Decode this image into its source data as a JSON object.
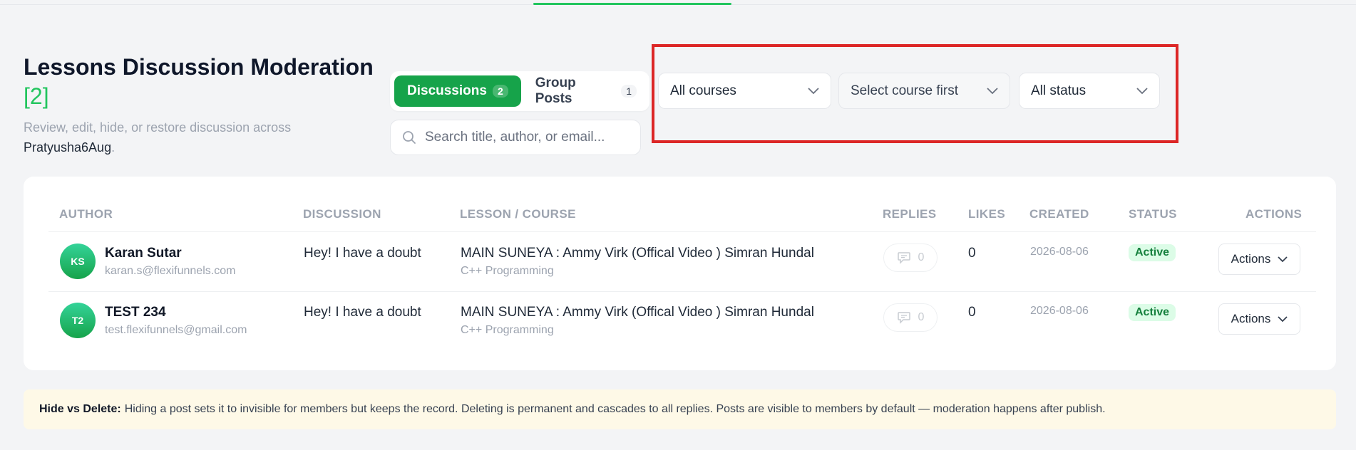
{
  "header": {
    "title": "Lessons Discussion Moderation",
    "count": "[2]",
    "subtitle_prefix": "Review, edit, hide, or restore discussion across",
    "site_name": "Pratyusha6Aug",
    "subtitle_suffix": "."
  },
  "tabs": [
    {
      "label": "Discussions",
      "badge": "2",
      "active": true
    },
    {
      "label": "Group Posts",
      "badge": "1",
      "active": false
    }
  ],
  "search": {
    "placeholder": "Search title, author, or email..."
  },
  "filters": {
    "courses": "All courses",
    "lessons": "Select course first",
    "status": "All status"
  },
  "table": {
    "columns": [
      "AUTHOR",
      "DISCUSSION",
      "LESSON / COURSE",
      "REPLIES",
      "LIKES",
      "CREATED",
      "STATUS",
      "ACTIONS"
    ],
    "rows": [
      {
        "initials": "KS",
        "author": "Karan Sutar",
        "email": "karan.s@flexifunnels.com",
        "discussion": "Hey! I have a doubt",
        "lesson": "MAIN SUNEYA : Ammy Virk (Offical Video ) Simran Hundal",
        "course": "C++ Programming",
        "replies": "0",
        "likes": "0",
        "created": "2026-08-06",
        "status": "Active",
        "actions": "Actions"
      },
      {
        "initials": "T2",
        "author": "TEST 234",
        "email": "test.flexifunnels@gmail.com",
        "discussion": "Hey! I have a doubt",
        "lesson": "MAIN SUNEYA : Ammy Virk (Offical Video ) Simran Hundal",
        "course": "C++ Programming",
        "replies": "0",
        "likes": "0",
        "created": "2026-08-06",
        "status": "Active",
        "actions": "Actions"
      }
    ]
  },
  "note": {
    "title": "Hide vs Delete:",
    "text": "Hiding a post sets it to invisible for members but keeps the record. Deleting is permanent and cascades to all replies. Posts are visible to members by default — moderation happens after publish."
  },
  "colors": {
    "accent": "#16a34a",
    "highlight": "#dc2626",
    "status_bg": "#dcfce7"
  }
}
